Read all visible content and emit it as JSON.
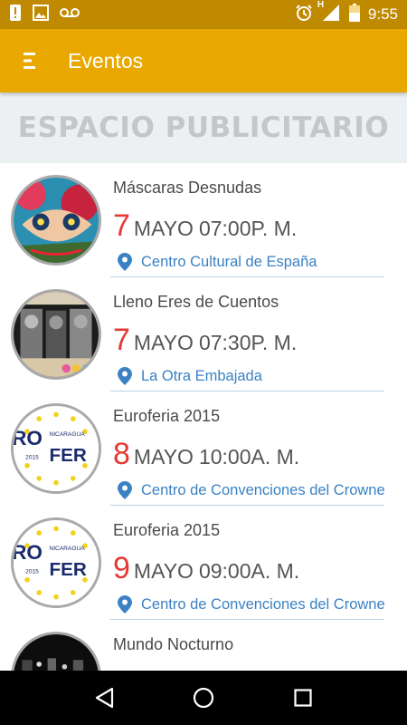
{
  "status_bar": {
    "time": "9:55",
    "icons": [
      "alert-icon",
      "image-icon",
      "voicemail-icon",
      "alarm-icon",
      "signal-h-icon",
      "battery-icon"
    ],
    "network_label": "H"
  },
  "app_bar": {
    "title": "Eventos",
    "menu_icon": "menu-icon",
    "background": "#e8a800"
  },
  "ad_banner": {
    "text": "ESPACIO PUBLICITARIO"
  },
  "events": [
    {
      "title": "Máscaras Desnudas",
      "day": "7",
      "month": "MAYO",
      "time": "07:00P. M.",
      "venue": "Centro Cultural de España",
      "image": "mask-art"
    },
    {
      "title": "Lleno Eres de Cuentos",
      "day": "7",
      "month": "MAYO",
      "time": "07:30P. M.",
      "venue": "La Otra Embajada",
      "image": "cuentos-poster"
    },
    {
      "title": "Euroferia 2015",
      "day": "8",
      "month": "MAYO",
      "time": "10:00A. M.",
      "venue": "Centro de Convenciones del Crowne",
      "image": "euroferia-logo",
      "logo_text": {
        "line1": "RO",
        "small": "NICARAGUA",
        "year": "2015",
        "line2": "FER"
      }
    },
    {
      "title": "Euroferia 2015",
      "day": "9",
      "month": "MAYO",
      "time": "09:00A. M.",
      "venue": "Centro de Convenciones del Crowne",
      "image": "euroferia-logo",
      "logo_text": {
        "line1": "RO",
        "small": "NICARAGUA",
        "year": "2015",
        "line2": "FER"
      }
    },
    {
      "title": "Mundo Nocturno",
      "day": "",
      "month": "",
      "time": "",
      "venue": "",
      "image": "night-stage"
    }
  ],
  "colors": {
    "day": "#e53935",
    "venue": "#3b82c4",
    "status_bar": "#c08a00"
  },
  "nav_bar": {
    "buttons": [
      "back-icon",
      "home-icon",
      "recents-icon"
    ]
  }
}
